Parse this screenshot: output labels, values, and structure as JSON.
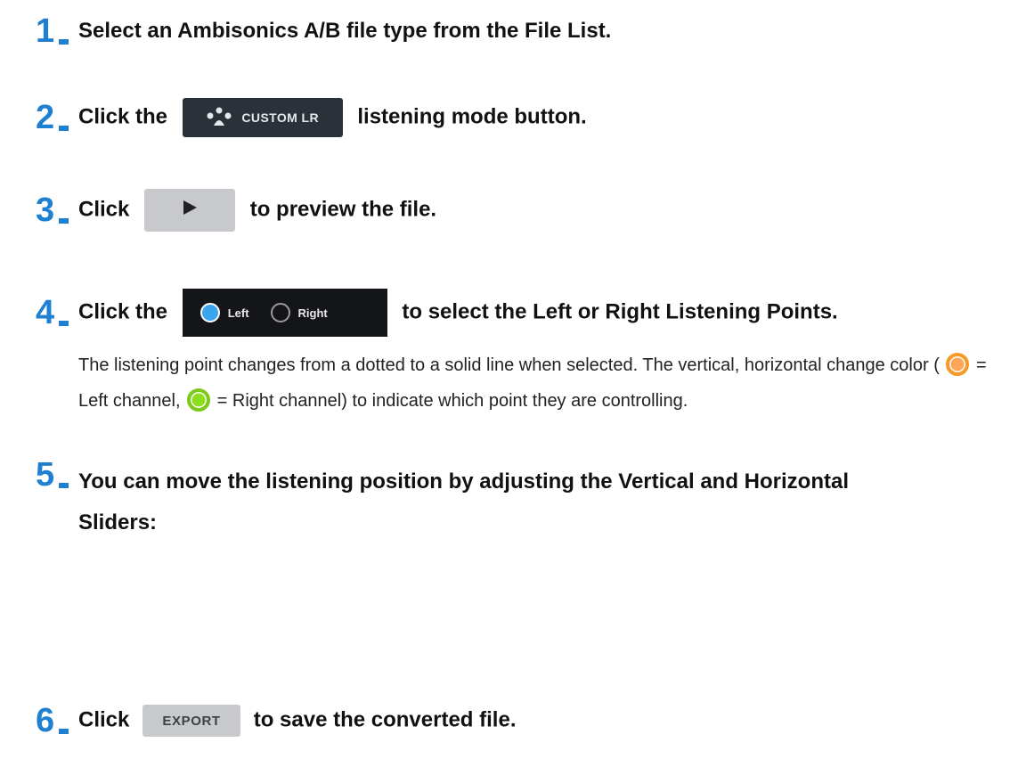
{
  "steps": [
    {
      "number": "1",
      "text": "Select an Ambisonics A/B file type from the File List."
    },
    {
      "number": "2",
      "prefix": "Click the",
      "button_label": "CUSTOM LR",
      "button_icon": "custom-lr-icon",
      "suffix": "listening mode button."
    },
    {
      "number": "3",
      "prefix": "Click",
      "button_icon": "play-icon",
      "suffix": "to preview the file."
    },
    {
      "number": "4",
      "prefix": "Click the",
      "radio_left": "Left",
      "radio_right": "Right",
      "radio_selected": "Left",
      "suffix": "to select the Left or Right Listening Points.",
      "description_part1": "The listening point changes from a dotted to a solid line when selected. The vertical, horizontal change color (",
      "left_swatch_label": "= Left channel,",
      "right_swatch_label": "= Right channel) to indicate which point they are controlling.",
      "left_color": "#f59a28",
      "right_color": "#7dc81c"
    },
    {
      "number": "5",
      "text": "You can move the listening position by adjusting the Vertical and Horizontal Sliders:"
    },
    {
      "number": "6",
      "prefix": "Click",
      "button_label": "EXPORT",
      "suffix": "to save the converted file."
    }
  ],
  "colors": {
    "step_number": "#1f7fd0",
    "dark_button": "#2b3138",
    "grey_button": "#c7c9cc",
    "radio_bar": "#141518",
    "radio_selected": "#3aa4ee"
  }
}
